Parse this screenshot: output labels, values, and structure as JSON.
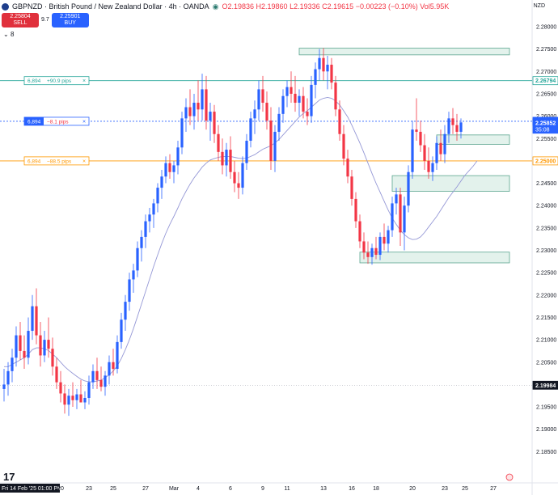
{
  "header": {
    "title": "GBPNZD · British Pound / New Zealand Dollar · 4h · OANDA",
    "open": "O2.19836",
    "high": "H2.19860",
    "low": "L2.19336",
    "close": "C2.19615",
    "change": "−0.00223 (−0.10%)",
    "volume": "Vol5.95K",
    "indicator_count": "8",
    "currency": "NZD"
  },
  "trade": {
    "sell_price": "2.25804",
    "sell_label": "SELL",
    "spread": "9.7",
    "buy_price": "2.25901",
    "buy_label": "BUY"
  },
  "colors": {
    "up": "#2962ff",
    "down": "#f23645",
    "ma": "#9598d6",
    "zone_fill": "#e3f2ec",
    "zone_stroke": "#5aa58f",
    "tp_line": "#26a69a",
    "entry_line": "#2962ff",
    "sl_line": "#ff9800"
  },
  "chart_data": {
    "type": "candlestick",
    "symbol": "GBPNZD",
    "timeframe": "4h",
    "ylim": [
      2.18,
      2.28
    ],
    "y_ticks": [
      "2.28000",
      "2.27500",
      "2.27000",
      "2.26500",
      "2.26000",
      "2.25500",
      "2.25000",
      "2.24500",
      "2.24000",
      "2.23500",
      "2.23000",
      "2.22500",
      "2.22000",
      "2.21500",
      "2.21000",
      "2.20500",
      "2.20000",
      "2.19500",
      "2.19000",
      "2.18500"
    ],
    "x_ticks": [
      {
        "label": "Fri 14 Feb '25  01:00 PM",
        "idx": 0
      },
      {
        "label": "20",
        "idx": 14
      },
      {
        "label": "23",
        "idx": 21
      },
      {
        "label": "25",
        "idx": 27
      },
      {
        "label": "27",
        "idx": 35
      },
      {
        "label": "Mar",
        "idx": 42
      },
      {
        "label": "4",
        "idx": 48
      },
      {
        "label": "6",
        "idx": 56
      },
      {
        "label": "9",
        "idx": 64
      },
      {
        "label": "11",
        "idx": 70
      },
      {
        "label": "13",
        "idx": 79
      },
      {
        "label": "16",
        "idx": 86
      },
      {
        "label": "18",
        "idx": 92
      },
      {
        "label": "20",
        "idx": 101
      },
      {
        "label": "23",
        "idx": 109
      },
      {
        "label": "25",
        "idx": 114
      },
      {
        "label": "27",
        "idx": 121
      }
    ],
    "price_labels": [
      {
        "value": 2.26794,
        "text": "2.26794",
        "color": "#26a69a",
        "style": "outline"
      },
      {
        "value": 2.25885,
        "text": "2.25885",
        "color": "#2962ff",
        "style": "fill"
      },
      {
        "value": 2.25852,
        "text": "2.25852",
        "color": "#2962ff",
        "style": "fill",
        "sub": "35:08"
      },
      {
        "value": 2.25,
        "text": "2.25000",
        "color": "#ff9800",
        "style": "outline"
      },
      {
        "value": 2.19984,
        "text": "2.19984",
        "color": "#131722",
        "style": "fill"
      }
    ],
    "order_lines": [
      {
        "qty": "6,894",
        "text": "+90.9 pips",
        "value": 2.26794,
        "color": "#26a69a"
      },
      {
        "qty": "6,894",
        "text": "−8.1 pips",
        "value": 2.25885,
        "color": "#2962ff"
      },
      {
        "qty": "6,894",
        "text": "−88.5 pips",
        "value": 2.25,
        "color": "#ff9800"
      }
    ],
    "zones": [
      {
        "from_idx": 73,
        "to_idx": 125,
        "low": 2.2737,
        "high": 2.2752
      },
      {
        "from_idx": 107,
        "to_idx": 125,
        "low": 2.2537,
        "high": 2.2558
      },
      {
        "from_idx": 96,
        "to_idx": 125,
        "low": 2.2432,
        "high": 2.2467
      },
      {
        "from_idx": 88,
        "to_idx": 125,
        "low": 2.2272,
        "high": 2.2296
      }
    ],
    "series": [
      {
        "open": 2.199,
        "high": 2.2035,
        "low": 2.1962,
        "close": 2.2
      },
      {
        "open": 2.2,
        "high": 2.205,
        "low": 2.1975,
        "close": 2.203
      },
      {
        "open": 2.203,
        "high": 2.208,
        "low": 2.2005,
        "close": 2.206
      },
      {
        "open": 2.206,
        "high": 2.213,
        "low": 2.204,
        "close": 2.211
      },
      {
        "open": 2.211,
        "high": 2.214,
        "low": 2.2055,
        "close": 2.2075
      },
      {
        "open": 2.2075,
        "high": 2.211,
        "low": 2.2035,
        "close": 2.206
      },
      {
        "open": 2.206,
        "high": 2.215,
        "low": 2.2045,
        "close": 2.212
      },
      {
        "open": 2.212,
        "high": 2.22,
        "low": 2.21,
        "close": 2.2175
      },
      {
        "open": 2.2175,
        "high": 2.2215,
        "low": 2.209,
        "close": 2.211
      },
      {
        "open": 2.211,
        "high": 2.214,
        "low": 2.204,
        "close": 2.2065
      },
      {
        "open": 2.2065,
        "high": 2.212,
        "low": 2.205,
        "close": 2.21
      },
      {
        "open": 2.21,
        "high": 2.215,
        "low": 2.206,
        "close": 2.208
      },
      {
        "open": 2.208,
        "high": 2.2105,
        "low": 2.202,
        "close": 2.204
      },
      {
        "open": 2.204,
        "high": 2.206,
        "low": 2.199,
        "close": 2.2005
      },
      {
        "open": 2.2005,
        "high": 2.203,
        "low": 2.196,
        "close": 2.198
      },
      {
        "open": 2.198,
        "high": 2.2,
        "low": 2.1935,
        "close": 2.1955
      },
      {
        "open": 2.1955,
        "high": 2.199,
        "low": 2.193,
        "close": 2.1975
      },
      {
        "open": 2.1975,
        "high": 2.2005,
        "low": 2.195,
        "close": 2.1965
      },
      {
        "open": 2.1965,
        "high": 2.199,
        "low": 2.1945,
        "close": 2.1978
      },
      {
        "open": 2.1978,
        "high": 2.201,
        "low": 2.196,
        "close": 2.196
      },
      {
        "open": 2.196,
        "high": 2.1985,
        "low": 2.1945,
        "close": 2.197
      },
      {
        "open": 2.197,
        "high": 2.202,
        "low": 2.1955,
        "close": 2.2005
      },
      {
        "open": 2.2005,
        "high": 2.2045,
        "low": 2.199,
        "close": 2.203
      },
      {
        "open": 2.203,
        "high": 2.206,
        "low": 2.199,
        "close": 2.201
      },
      {
        "open": 2.201,
        "high": 2.204,
        "low": 2.1985,
        "close": 2.1995
      },
      {
        "open": 2.1995,
        "high": 2.203,
        "low": 2.1975,
        "close": 2.202
      },
      {
        "open": 2.202,
        "high": 2.2065,
        "low": 2.2,
        "close": 2.205
      },
      {
        "open": 2.205,
        "high": 2.208,
        "low": 2.202,
        "close": 2.2035
      },
      {
        "open": 2.2035,
        "high": 2.211,
        "low": 2.2025,
        "close": 2.2095
      },
      {
        "open": 2.2095,
        "high": 2.216,
        "low": 2.208,
        "close": 2.2145
      },
      {
        "open": 2.2145,
        "high": 2.22,
        "low": 2.212,
        "close": 2.2185
      },
      {
        "open": 2.2185,
        "high": 2.225,
        "low": 2.2165,
        "close": 2.2235
      },
      {
        "open": 2.2235,
        "high": 2.227,
        "low": 2.2205,
        "close": 2.2255
      },
      {
        "open": 2.2255,
        "high": 2.232,
        "low": 2.224,
        "close": 2.2305
      },
      {
        "open": 2.2305,
        "high": 2.2345,
        "low": 2.2275,
        "close": 2.233
      },
      {
        "open": 2.233,
        "high": 2.238,
        "low": 2.2305,
        "close": 2.2365
      },
      {
        "open": 2.2365,
        "high": 2.2395,
        "low": 2.234,
        "close": 2.238
      },
      {
        "open": 2.238,
        "high": 2.2415,
        "low": 2.235,
        "close": 2.2405
      },
      {
        "open": 2.2405,
        "high": 2.245,
        "low": 2.2385,
        "close": 2.244
      },
      {
        "open": 2.244,
        "high": 2.248,
        "low": 2.2415,
        "close": 2.2465
      },
      {
        "open": 2.2465,
        "high": 2.251,
        "low": 2.245,
        "close": 2.2495
      },
      {
        "open": 2.2495,
        "high": 2.2515,
        "low": 2.246,
        "close": 2.2475
      },
      {
        "open": 2.2475,
        "high": 2.25,
        "low": 2.245,
        "close": 2.249
      },
      {
        "open": 2.249,
        "high": 2.2545,
        "low": 2.247,
        "close": 2.253
      },
      {
        "open": 2.253,
        "high": 2.261,
        "low": 2.2515,
        "close": 2.2595
      },
      {
        "open": 2.2595,
        "high": 2.264,
        "low": 2.2565,
        "close": 2.262
      },
      {
        "open": 2.262,
        "high": 2.266,
        "low": 2.258,
        "close": 2.26
      },
      {
        "open": 2.26,
        "high": 2.265,
        "low": 2.257,
        "close": 2.263
      },
      {
        "open": 2.263,
        "high": 2.268,
        "low": 2.259,
        "close": 2.2615
      },
      {
        "open": 2.2615,
        "high": 2.2695,
        "low": 2.259,
        "close": 2.266
      },
      {
        "open": 2.266,
        "high": 2.269,
        "low": 2.257,
        "close": 2.259
      },
      {
        "open": 2.259,
        "high": 2.263,
        "low": 2.2545,
        "close": 2.261
      },
      {
        "open": 2.261,
        "high": 2.2625,
        "low": 2.254,
        "close": 2.256
      },
      {
        "open": 2.256,
        "high": 2.258,
        "low": 2.25,
        "close": 2.252
      },
      {
        "open": 2.252,
        "high": 2.255,
        "low": 2.247,
        "close": 2.249
      },
      {
        "open": 2.249,
        "high": 2.254,
        "low": 2.2465,
        "close": 2.2525
      },
      {
        "open": 2.2525,
        "high": 2.2555,
        "low": 2.246,
        "close": 2.2475
      },
      {
        "open": 2.2475,
        "high": 2.25,
        "low": 2.243,
        "close": 2.245
      },
      {
        "open": 2.245,
        "high": 2.2475,
        "low": 2.2415,
        "close": 2.244
      },
      {
        "open": 2.244,
        "high": 2.251,
        "low": 2.2425,
        "close": 2.2495
      },
      {
        "open": 2.2495,
        "high": 2.256,
        "low": 2.248,
        "close": 2.2545
      },
      {
        "open": 2.2545,
        "high": 2.261,
        "low": 2.253,
        "close": 2.2595
      },
      {
        "open": 2.2595,
        "high": 2.2635,
        "low": 2.256,
        "close": 2.2615
      },
      {
        "open": 2.2615,
        "high": 2.268,
        "low": 2.259,
        "close": 2.266
      },
      {
        "open": 2.266,
        "high": 2.269,
        "low": 2.261,
        "close": 2.263
      },
      {
        "open": 2.263,
        "high": 2.2655,
        "low": 2.257,
        "close": 2.259
      },
      {
        "open": 2.259,
        "high": 2.262,
        "low": 2.248,
        "close": 2.25
      },
      {
        "open": 2.25,
        "high": 2.258,
        "low": 2.2475,
        "close": 2.2565
      },
      {
        "open": 2.2565,
        "high": 2.262,
        "low": 2.2545,
        "close": 2.2605
      },
      {
        "open": 2.2605,
        "high": 2.266,
        "low": 2.2585,
        "close": 2.2645
      },
      {
        "open": 2.2645,
        "high": 2.268,
        "low": 2.262,
        "close": 2.2665
      },
      {
        "open": 2.2665,
        "high": 2.27,
        "low": 2.263,
        "close": 2.265
      },
      {
        "open": 2.265,
        "high": 2.269,
        "low": 2.261,
        "close": 2.263
      },
      {
        "open": 2.263,
        "high": 2.266,
        "low": 2.26,
        "close": 2.2645
      },
      {
        "open": 2.2645,
        "high": 2.2665,
        "low": 2.2595,
        "close": 2.261
      },
      {
        "open": 2.261,
        "high": 2.264,
        "low": 2.258,
        "close": 2.26
      },
      {
        "open": 2.26,
        "high": 2.269,
        "low": 2.2585,
        "close": 2.267
      },
      {
        "open": 2.267,
        "high": 2.272,
        "low": 2.264,
        "close": 2.2705
      },
      {
        "open": 2.2705,
        "high": 2.275,
        "low": 2.268,
        "close": 2.273
      },
      {
        "open": 2.273,
        "high": 2.2752,
        "low": 2.268,
        "close": 2.27
      },
      {
        "open": 2.27,
        "high": 2.2735,
        "low": 2.266,
        "close": 2.2715
      },
      {
        "open": 2.2715,
        "high": 2.273,
        "low": 2.266,
        "close": 2.2675
      },
      {
        "open": 2.2675,
        "high": 2.269,
        "low": 2.26,
        "close": 2.2615
      },
      {
        "open": 2.2615,
        "high": 2.2635,
        "low": 2.2545,
        "close": 2.256
      },
      {
        "open": 2.256,
        "high": 2.258,
        "low": 2.249,
        "close": 2.2505
      },
      {
        "open": 2.2505,
        "high": 2.2525,
        "low": 2.245,
        "close": 2.2465
      },
      {
        "open": 2.2465,
        "high": 2.248,
        "low": 2.24,
        "close": 2.2415
      },
      {
        "open": 2.2415,
        "high": 2.243,
        "low": 2.235,
        "close": 2.2365
      },
      {
        "open": 2.2365,
        "high": 2.238,
        "low": 2.2305,
        "close": 2.232
      },
      {
        "open": 2.232,
        "high": 2.234,
        "low": 2.228,
        "close": 2.2295
      },
      {
        "open": 2.2295,
        "high": 2.232,
        "low": 2.227,
        "close": 2.2285
      },
      {
        "open": 2.2285,
        "high": 2.2315,
        "low": 2.2268,
        "close": 2.2305
      },
      {
        "open": 2.2305,
        "high": 2.233,
        "low": 2.228,
        "close": 2.229
      },
      {
        "open": 2.229,
        "high": 2.234,
        "low": 2.2278,
        "close": 2.233
      },
      {
        "open": 2.233,
        "high": 2.236,
        "low": 2.23,
        "close": 2.2315
      },
      {
        "open": 2.2315,
        "high": 2.2355,
        "low": 2.2295,
        "close": 2.2345
      },
      {
        "open": 2.2345,
        "high": 2.242,
        "low": 2.233,
        "close": 2.2405
      },
      {
        "open": 2.2405,
        "high": 2.244,
        "low": 2.238,
        "close": 2.2425
      },
      {
        "open": 2.2425,
        "high": 2.244,
        "low": 2.231,
        "close": 2.234
      },
      {
        "open": 2.234,
        "high": 2.242,
        "low": 2.23,
        "close": 2.24
      },
      {
        "open": 2.24,
        "high": 2.249,
        "low": 2.2385,
        "close": 2.2475
      },
      {
        "open": 2.2475,
        "high": 2.259,
        "low": 2.246,
        "close": 2.257
      },
      {
        "open": 2.257,
        "high": 2.264,
        "low": 2.2545,
        "close": 2.2565
      },
      {
        "open": 2.2565,
        "high": 2.259,
        "low": 2.252,
        "close": 2.2535
      },
      {
        "open": 2.2535,
        "high": 2.256,
        "low": 2.248,
        "close": 2.25
      },
      {
        "open": 2.25,
        "high": 2.253,
        "low": 2.246,
        "close": 2.2475
      },
      {
        "open": 2.2475,
        "high": 2.251,
        "low": 2.2455,
        "close": 2.2495
      },
      {
        "open": 2.2495,
        "high": 2.2555,
        "low": 2.248,
        "close": 2.254
      },
      {
        "open": 2.254,
        "high": 2.257,
        "low": 2.25,
        "close": 2.2515
      },
      {
        "open": 2.2515,
        "high": 2.258,
        "low": 2.2495,
        "close": 2.256
      },
      {
        "open": 2.256,
        "high": 2.261,
        "low": 2.254,
        "close": 2.2595
      },
      {
        "open": 2.2595,
        "high": 2.2618,
        "low": 2.256,
        "close": 2.258
      },
      {
        "open": 2.258,
        "high": 2.2605,
        "low": 2.2545,
        "close": 2.2565
      },
      {
        "open": 2.2565,
        "high": 2.2595,
        "low": 2.255,
        "close": 2.2586
      }
    ],
    "ma": [
      2.204,
      2.204,
      2.2045,
      2.205,
      2.2055,
      2.206,
      2.2068,
      2.2078,
      2.2082,
      2.2082,
      2.208,
      2.2076,
      2.2068,
      2.206,
      2.205,
      2.204,
      2.2032,
      2.2025,
      2.2018,
      2.2012,
      2.2008,
      2.2006,
      2.2006,
      2.2008,
      2.201,
      2.2015,
      2.2022,
      2.203,
      2.2042,
      2.2058,
      2.2078,
      2.21,
      2.2125,
      2.2152,
      2.218,
      2.2208,
      2.2236,
      2.2264,
      2.229,
      2.2315,
      2.2338,
      2.2358,
      2.2376,
      2.2395,
      2.2415,
      2.2432,
      2.2448,
      2.2462,
      2.2474,
      2.2486,
      2.2495,
      2.2502,
      2.2505,
      2.2508,
      2.251,
      2.251,
      2.251,
      2.2508,
      2.2506,
      2.2505,
      2.2506,
      2.251,
      2.2514,
      2.252,
      2.2526,
      2.253,
      2.2534,
      2.254,
      2.2548,
      2.2558,
      2.2568,
      2.2578,
      2.2588,
      2.2598,
      2.2606,
      2.2612,
      2.262,
      2.2628,
      2.2636,
      2.264,
      2.2642,
      2.264,
      2.2634,
      2.2625,
      2.2612,
      2.2598,
      2.258,
      2.256,
      2.254,
      2.2518,
      2.2495,
      2.2472,
      2.245,
      2.243,
      2.241,
      2.239,
      2.2372,
      2.2358,
      2.2345,
      2.2335,
      2.2328,
      2.2324,
      2.2325,
      2.233,
      2.234,
      2.2352,
      2.2364,
      2.2376,
      2.239,
      2.2404,
      2.2418,
      2.243,
      2.2442,
      2.2455,
      2.2468,
      2.2478,
      2.2488,
      2.25
    ]
  }
}
